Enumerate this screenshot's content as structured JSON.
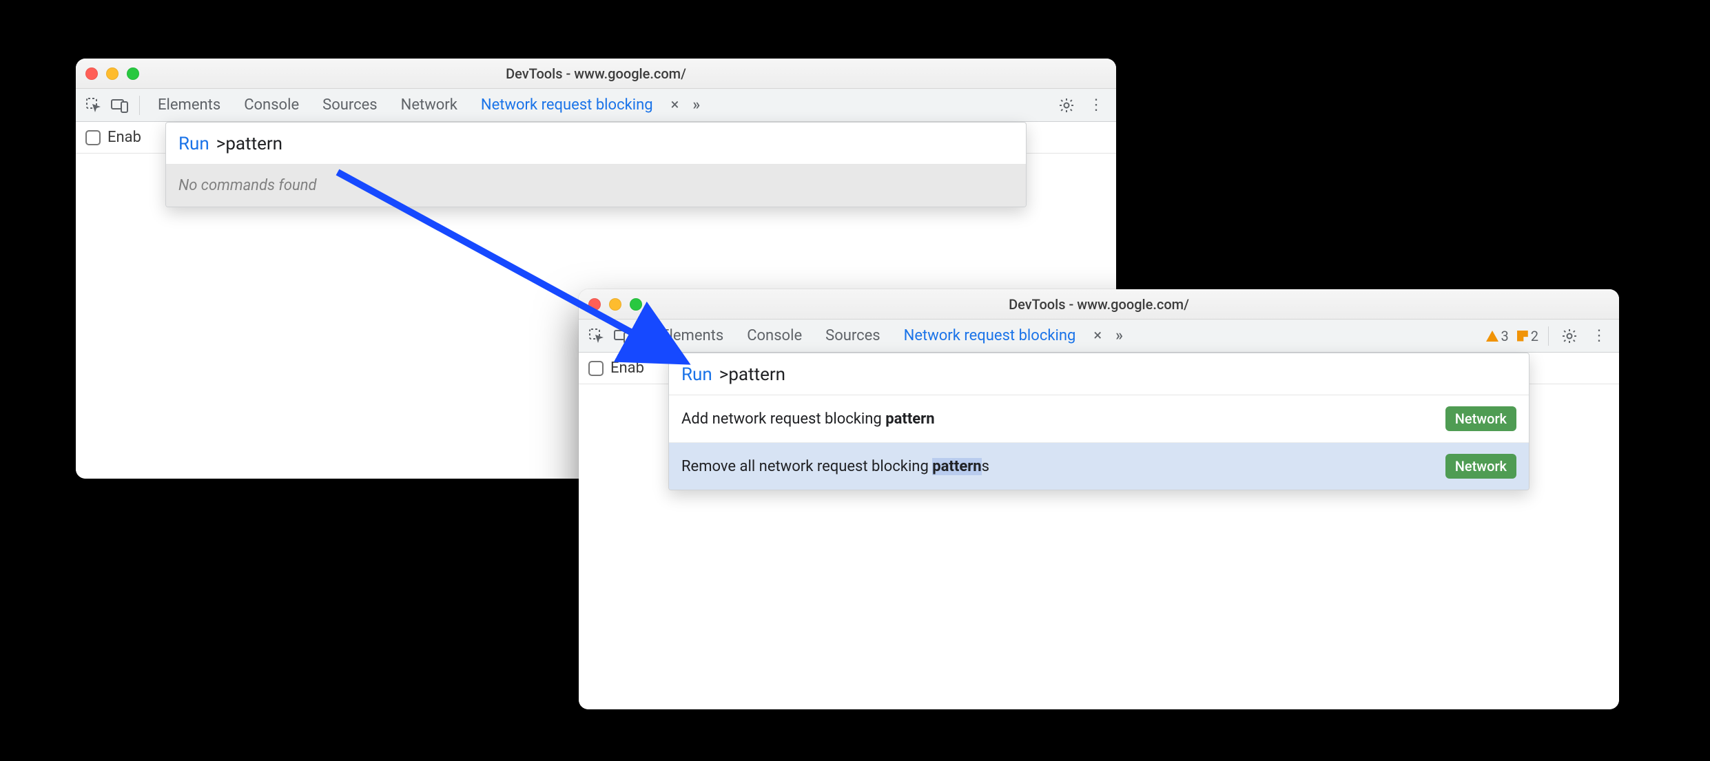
{
  "windowA": {
    "title": "DevTools - www.google.com/",
    "tabs": {
      "elements": "Elements",
      "console": "Console",
      "sources": "Sources",
      "network": "Network",
      "blocking": "Network request blocking"
    },
    "panel": {
      "checkbox_label_partial": "Enab"
    },
    "cmd": {
      "run_label": "Run",
      "query": ">pattern",
      "empty": "No commands found"
    }
  },
  "windowB": {
    "title": "DevTools - www.google.com/",
    "tabs": {
      "elements": "Elements",
      "console": "Console",
      "sources": "Sources",
      "blocking": "Network request blocking"
    },
    "counts": {
      "warnings": "3",
      "issues": "2"
    },
    "panel": {
      "checkbox_label_partial": "Enab"
    },
    "cmd": {
      "run_label": "Run",
      "query": ">pattern",
      "results": [
        {
          "text_before": "Add network request blocking ",
          "match": "pattern",
          "text_after": "",
          "badge": "Network"
        },
        {
          "text_before": "Remove all network request blocking ",
          "match": "pattern",
          "text_after": "s",
          "badge": "Network"
        }
      ]
    }
  }
}
